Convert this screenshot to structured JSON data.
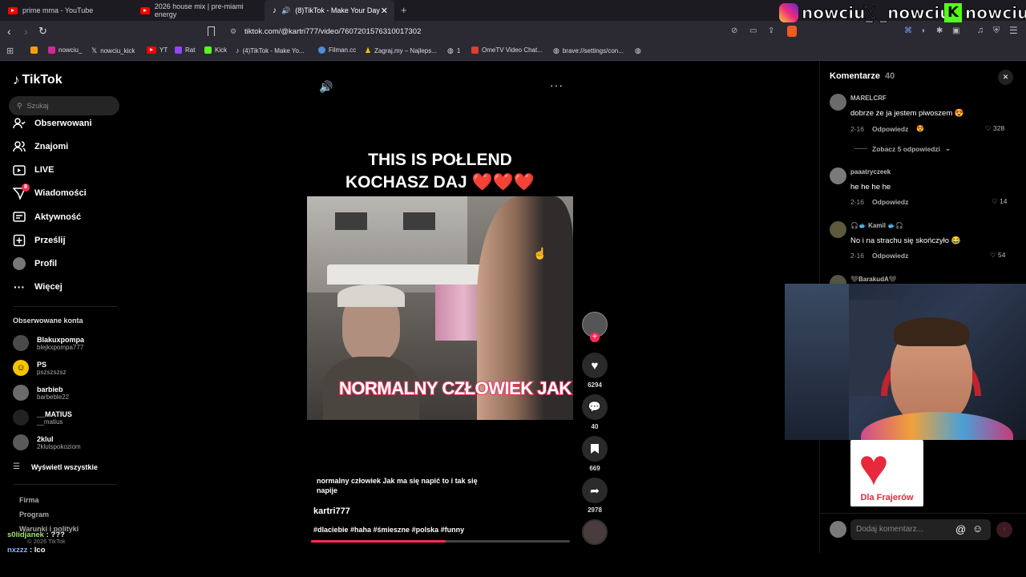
{
  "browser": {
    "tabs": [
      {
        "label": "prime mma - YouTube"
      },
      {
        "label": "2026 house mix | pre-miami energy"
      },
      {
        "label": "(8)TikTok - Make Your Day"
      }
    ],
    "url": "tiktok.com/@kartri777/video/7607201576310017302",
    "bookmarks": [
      "nowciu_",
      "nowciu_kick",
      "YT",
      "Rat",
      "Kick",
      "(4)TikTok - Make Yo...",
      "Filman.cc",
      "Zagraj.my – Najleps...",
      "1",
      "OmeTV Video Chat...",
      "brave://settings/con..."
    ]
  },
  "overlay": {
    "instagram": "nowciu_",
    "x": "_nowciu",
    "kick": "nowciu",
    "chat": [
      {
        "user": "s0lidjanek",
        "msg": "???"
      },
      {
        "user": "nxzzz",
        "msg": "lco"
      }
    ],
    "sticker_text": "Dla Frajerów"
  },
  "sidebar": {
    "logo": "TikTok",
    "search_placeholder": "Szukaj",
    "nav": [
      "Obserwowani",
      "Znajomi",
      "LIVE",
      "Wiadomości",
      "Aktywność",
      "Prześlij",
      "Profil",
      "Więcej"
    ],
    "messages_badge": "8",
    "followed_title": "Obserwowane konta",
    "accounts": [
      {
        "name": "Blakuxpompa",
        "handle": "blejkxpompa777"
      },
      {
        "name": "PS",
        "handle": "pszszszsz"
      },
      {
        "name": "barbieb",
        "handle": "barbeble22"
      },
      {
        "name": "__MATIUS",
        "handle": "__matius"
      },
      {
        "name": "2klul",
        "handle": "2klulspokoziom"
      }
    ],
    "show_all": "Wyświetl wszystkie",
    "footer": [
      "Firma",
      "Program",
      "Warunki i polityki",
      "© 2026 TikTok"
    ]
  },
  "video": {
    "title_line1": "THIS IS POŁLEND",
    "title_line2": "KOCHASZ DAJ ❤️❤️❤️",
    "subtitle": "NORMALNY CZŁOWIEK JAK",
    "description": "normalny człowiek Jak ma się napić to i tak się napije",
    "author": "kartri777",
    "hashtags": "#dlaciebie #haha #śmieszne #polska #funny",
    "progress": 0.52,
    "likes": "6294",
    "comments": "40",
    "saves": "669",
    "shares": "2978"
  },
  "comments": {
    "title": "Komentarze",
    "count": "40",
    "reply_label": "Odpowiedz",
    "items": [
      {
        "user": "MARELCRF",
        "text": "dobrze że ja jestem piwoszem 😍",
        "date": "2-16",
        "likes": "328"
      },
      {
        "user": "paaatryczeek",
        "text": "he he he he",
        "date": "2-16",
        "likes": "14"
      },
      {
        "user": "🎧🐟 Kamil 🐟🎧",
        "text": "No i na strachu się skończyło 😂",
        "date": "2-16",
        "likes": "54"
      },
      {
        "user": "🖤BarakudA🖤"
      }
    ],
    "view_replies": "Zobacz 5 odpowiedzi",
    "add_placeholder": "Dodaj komentarz..."
  }
}
